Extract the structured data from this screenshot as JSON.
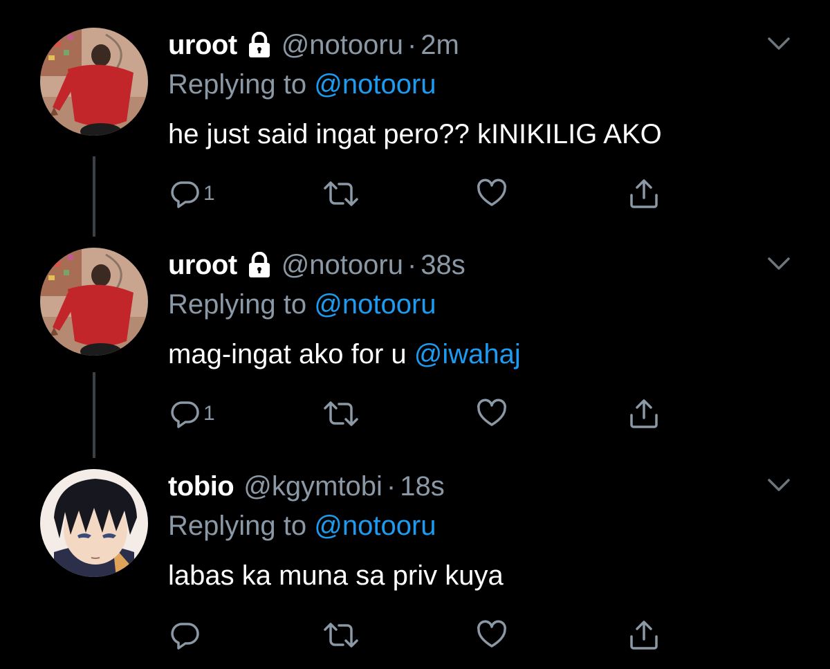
{
  "theme": {
    "background": "#000000",
    "text": "#ffffff",
    "secondary": "#8b98a5",
    "link": "#1d9bf0",
    "thread_line": "#3d4045"
  },
  "tweets": [
    {
      "name": "uroot",
      "protected": true,
      "handle": "@notooru",
      "dot": "·",
      "time": "2m",
      "replying_prefix": "Replying to ",
      "replying_to": "@notooru",
      "text": "he just said ingat pero?? kINIKILIG AKO",
      "text_mention": "",
      "reply_count": "1",
      "avatar": "red-shirt-person-avatar"
    },
    {
      "name": "uroot",
      "protected": true,
      "handle": "@notooru",
      "dot": "·",
      "time": "38s",
      "replying_prefix": "Replying to ",
      "replying_to": "@notooru",
      "text": "mag-ingat ako for u ",
      "text_mention": "@iwahaj",
      "reply_count": "1",
      "avatar": "red-shirt-person-avatar"
    },
    {
      "name": "tobio",
      "protected": false,
      "handle": "@kgymtobi",
      "dot": "·",
      "time": "18s",
      "replying_prefix": "Replying to ",
      "replying_to": "@notooru",
      "text": "labas ka muna sa priv kuya",
      "text_mention": "",
      "reply_count": "",
      "avatar": "anime-boy-avatar"
    }
  ],
  "icons": [
    "lock-icon",
    "chevron-down-icon",
    "reply-icon",
    "retweet-icon",
    "like-icon",
    "share-icon"
  ]
}
